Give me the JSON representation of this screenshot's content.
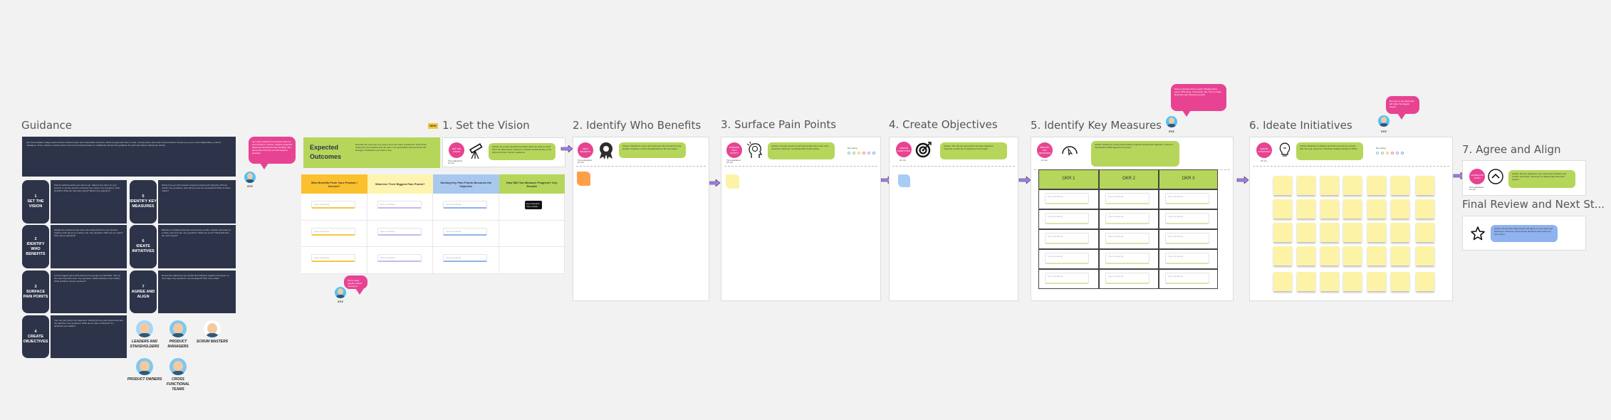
{
  "guidance": {
    "title": "Guidance",
    "intro": "Use this template to align teams around a shared vision and measurable outcomes. Work through each step in order, moving sticky notes and content between frames as you go. Invite stakeholders, product managers, scrum masters, product owners and cross-functional teams to collaborate. Review the guidance for each step before starting the activity.",
    "steps": [
      {
        "number": "1",
        "label": "SET THE VISION",
        "text": "Start by defining where you want to go. Capture the vision for your product or service and the outcomes you expect. Key questions: Who benefits? What are their pain points? What is the objective?"
      },
      {
        "number": "2",
        "label": "IDENTIFY WHO BENEFITS",
        "text": "Identify the customers and users who will benefit from your product. Capture each group on a sticky note. Key questions: Who are our users? Who else is impacted?"
      },
      {
        "number": "3",
        "label": "SURFACE PAIN POINTS",
        "text": "List the biggest pain points faced by the groups you identified. Vote on the most important ones. Key questions: What frustrates users today? What problems remain unsolved?"
      },
      {
        "number": "4",
        "label": "CREATE OBJECTIVES",
        "text": "Turn the pain points into objectives. Solving the key pain points becomes the objective. Key questions: What do we want to achieve? Is it ambitious yet realistic?"
      },
      {
        "number": "5",
        "label": "IDENTIFY KEY MEASURES",
        "text": "Define how you will measure progress toward each objective with key results. Key questions: How will we know we succeeded? What numbers matter?"
      },
      {
        "number": "6",
        "label": "IDEATE INITIATIVES",
        "text": "Brainstorm initiatives that will move the key results. Capture each idea on a sticky note and vote. Key questions: What can we do? What will have the most impact?"
      },
      {
        "number": "7",
        "label": "AGREE AND ALIGN",
        "text": "Review the objectives, key results and initiatives together and agree on next steps. Key questions: Are we aligned? Who owns what?"
      }
    ],
    "personas": [
      {
        "label": "LEADERS AND STAKEHOLDERS"
      },
      {
        "label": "PRODUCT MANAGERS"
      },
      {
        "label": "SCRUM MASTERS"
      },
      {
        "label": "PRODUCT OWNERS"
      },
      {
        "label": "CROSS FUNCTIONAL TEAMS"
      }
    ]
  },
  "bubbles": {
    "guidance_comment": "As a team brainstorm the future vision of your product or service. Capture expected outcomes and discuss who benefits, their pain points and how you will measure progress.",
    "vision_comment": "Fill the table together before moving on.",
    "measures_comment": "Some examples of key results: Weekly active users, NPS score, Conversion rate, Time to value, Retention rate, Revenue growth.",
    "initiatives_comment": "Dot vote on the ideas that will make the biggest impact.",
    "avatar_name": "XYZ"
  },
  "frames": {
    "vision": {
      "title": "1. Set the Vision",
      "badge": "NEW",
      "expected_outcomes_title": "Expected Outcomes",
      "expected_outcomes_text": "Describe the outcomes you expect once the vision is achieved. Think about customers, the business and the team. List measurable improvements and changes in behaviour you hope to see.",
      "circle_label": "SET THE VISION",
      "caption": "Time allocated: 15 min",
      "instructions": "Activity: As a team describe the future state you want to reach. Fill in the table below. Outcome: A shared understanding of the vision and how it will be measured.",
      "columns": [
        {
          "header": "Who Benefits From Your Product / Service?",
          "color": "#fbc02d"
        },
        {
          "header": "What Are Their Biggest Pain Points?",
          "color": "#fff3b0"
        },
        {
          "header": "Solving Key Pain Points Becomes the Objective",
          "color": "#a9c8f0"
        },
        {
          "header": "How Will You Measure Progress? Key Results",
          "color": "#b5d65a"
        }
      ],
      "input_placeholder": "Type something",
      "key_results_chip": "Key measures / Key results"
    },
    "benefits": {
      "title": "2. Identify Who Benefits",
      "circle_label": "WHO BENEFITS",
      "caption": "Time allocated: 10 min",
      "instructions": "Activity: Identify the users and customers who benefit from the product. Outcome: A list of beneficiaries for the next steps."
    },
    "pain_points": {
      "title": "3. Surface Pain Points",
      "circle_label": "SURFACE PAIN POINTS",
      "caption": "Time allocated: 15 min",
      "instructions": "Activity: List pain points for each group and vote on the most important. Outcome: A prioritised list of pain points.",
      "voting_label": "Dot voting"
    },
    "objectives": {
      "title": "4. Create Objectives",
      "circle_label": "CREATE OBJECTIVES",
      "caption": "10 min",
      "instructions": "Activity: Turn the top pain points into clear objectives. Outcome: A short list of objectives for the team."
    },
    "measures": {
      "title": "5. Identify Key Measures",
      "circle_label": "IDENTIFY KEY MEASURES",
      "caption": "10 min",
      "instructions": "Activity: Define key results that measure progress toward each objective. Outcome: Measurable OKRs agreed by the team.",
      "okr_headers": [
        "OKR 1",
        "OKR 2",
        "OKR 3"
      ],
      "input_placeholder": "Type something",
      "rows": 5
    },
    "initiatives": {
      "title": "6. Ideate Initiatives",
      "circle_label": "IDEATE INITIATIVES",
      "caption": "15 min",
      "instructions": "Activity: Brainstorm initiatives that will move the key results, then dot vote. Outcome: Prioritised initiatives linked to OKRs.",
      "voting_label": "Dot voting",
      "sticky_rows": 5,
      "sticky_cols": 7
    },
    "agree": {
      "title": "7. Agree and Align",
      "circle_label": "AGREE AND ALIGN",
      "caption": "Time allocated: 10 min",
      "instructions": "Activity: Review objectives, key results and initiatives and confirm ownership. Outcome: An aligned plan with clear owners."
    },
    "final": {
      "title": "Final Review and Next St...",
      "instructions": "Activity: Review the whole board and agree on next steps and follow-ups. Outcome: Documented decisions and owners for each action."
    }
  },
  "colors": {
    "accent_pink": "#e84393",
    "accent_green": "#b5d65a",
    "guidance_navy": "#2d3348",
    "arrow_purple": "#a57cf0",
    "sticky_yellow": "#fdf3a6",
    "sticky_orange": "#ff9f4a",
    "sticky_blue": "#a9ccf5"
  }
}
